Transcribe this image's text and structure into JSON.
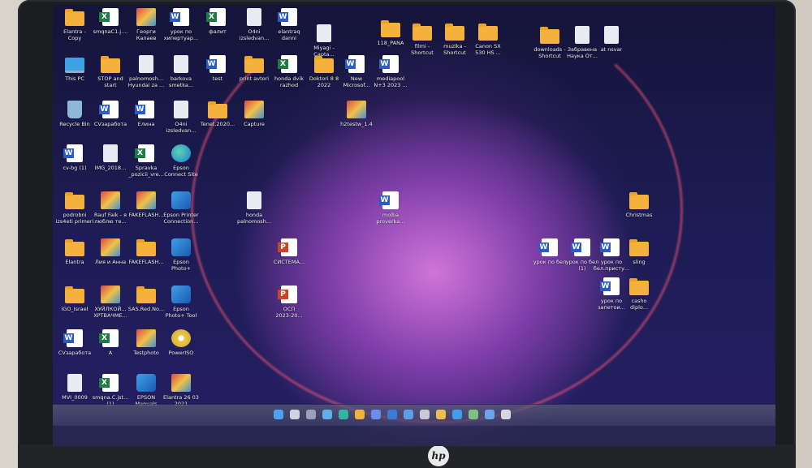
{
  "device": {
    "brand_logo": "hp"
  },
  "desktop_icons": [
    {
      "type": "folder",
      "label": "Elantra -\nCopy"
    },
    {
      "type": "excel",
      "label": "smqnaC1.j...."
    },
    {
      "type": "img",
      "label": "Георги\nКалаев"
    },
    {
      "type": "word",
      "label": "урок по\nхипертуар..."
    },
    {
      "type": "excel",
      "label": "фалит"
    },
    {
      "type": "file",
      "label": "O4ni\nizsledvan..."
    },
    {
      "type": "word",
      "label": "elantraq\ndanni"
    },
    {
      "type": "file",
      "label": "Miyagi -\nCapta..."
    },
    {
      "type": "folder",
      "label": "118_PANA"
    },
    {
      "type": "folder",
      "label": "filmi -\nShortcut"
    },
    {
      "type": "folder",
      "label": "muzika -\nShortcut"
    },
    {
      "type": "folder",
      "label": "Canon SX\n530 HS ..."
    },
    {
      "type": "folder",
      "label": "downloads -\nShortcut"
    },
    {
      "type": "file",
      "label": "Забравена\nНаука От..."
    },
    {
      "type": "file",
      "label": "at nsvar"
    },
    {
      "type": "pc",
      "label": "This PC"
    },
    {
      "type": "folder",
      "label": "STOP and\nstart"
    },
    {
      "type": "file",
      "label": "palnomosh...\nHyundai za ..."
    },
    {
      "type": "file",
      "label": "barkova\nsmetka..."
    },
    {
      "type": "word",
      "label": "test"
    },
    {
      "type": "folder",
      "label": "print avtori"
    },
    {
      "type": "excel",
      "label": "honda dvik\nrazhod"
    },
    {
      "type": "folder",
      "label": "Doktori 8 8\n2022"
    },
    {
      "type": "word",
      "label": "New\nMicrosof..."
    },
    {
      "type": "word",
      "label": "mediapool\nN+3 2023 ..."
    },
    {
      "type": "bin",
      "label": "Recycle Bin"
    },
    {
      "type": "word",
      "label": "CVзаработа"
    },
    {
      "type": "word",
      "label": "Елина"
    },
    {
      "type": "file",
      "label": "O4ni\nizsledvan..."
    },
    {
      "type": "folder",
      "label": "Tenet.2020..."
    },
    {
      "type": "img",
      "label": "Capture"
    },
    {
      "type": "img",
      "label": "h2testw_1.4"
    },
    {
      "type": "word",
      "label": "cv-bg (1)"
    },
    {
      "type": "file",
      "label": "IMG_2018..."
    },
    {
      "type": "excel",
      "label": "Spravka\n_pozicii_vre..."
    },
    {
      "type": "edge",
      "label": "Epson\nConnect Site"
    },
    {
      "type": "folder",
      "label": "podrobni\nizs4eti primeri"
    },
    {
      "type": "img",
      "label": "Rauf Faik - я\nлюблю те..."
    },
    {
      "type": "img",
      "label": "FAKEFLASH..."
    },
    {
      "type": "app",
      "label": "Epson Printer\nConnection..."
    },
    {
      "type": "file",
      "label": "honda\npalnomosh..."
    },
    {
      "type": "word",
      "label": "molba\nproverka..."
    },
    {
      "type": "folder",
      "label": "Christmas"
    },
    {
      "type": "folder",
      "label": "Elantra"
    },
    {
      "type": "img",
      "label": "Лия и Анна"
    },
    {
      "type": "folder",
      "label": "FAKEFLASH..."
    },
    {
      "type": "app",
      "label": "Epson\nPhoto+"
    },
    {
      "type": "ppt",
      "label": "СИСТЕМА..."
    },
    {
      "type": "word",
      "label": "урок по бел"
    },
    {
      "type": "word",
      "label": "урок по бел\n(1)"
    },
    {
      "type": "word",
      "label": "урок по\nбел.присту..."
    },
    {
      "type": "folder",
      "label": "sling"
    },
    {
      "type": "folder",
      "label": "iGO_Israel"
    },
    {
      "type": "img",
      "label": "ХУЙЛКОЙ...\nХРТВАЧМЕ..."
    },
    {
      "type": "folder",
      "label": "SAS.Red.No..."
    },
    {
      "type": "app",
      "label": "Epson\nPhoto+ Tool"
    },
    {
      "type": "ppt",
      "label": "ОСП\n2023-20..."
    },
    {
      "type": "word",
      "label": "урок по\nзапетои..."
    },
    {
      "type": "folder",
      "label": "casho\ndiplo..."
    },
    {
      "type": "word",
      "label": "CVзаработа"
    },
    {
      "type": "excel",
      "label": "A"
    },
    {
      "type": "img",
      "label": "Testphoto"
    },
    {
      "type": "disc",
      "label": "PowerISO"
    },
    {
      "type": "file",
      "label": "MVI_0009"
    },
    {
      "type": "excel",
      "label": "smqna.C.jst...\n(1)"
    },
    {
      "type": "app",
      "label": "EPSON\nManuals"
    },
    {
      "type": "img",
      "label": "Elantra 26 03\n2021"
    }
  ],
  "taskbar": {
    "icons": [
      "windows-start",
      "search",
      "task-view",
      "widgets",
      "edge",
      "file-explorer",
      "store",
      "mail",
      "photos",
      "settings",
      "chrome",
      "app",
      "app",
      "app",
      "app"
    ]
  }
}
